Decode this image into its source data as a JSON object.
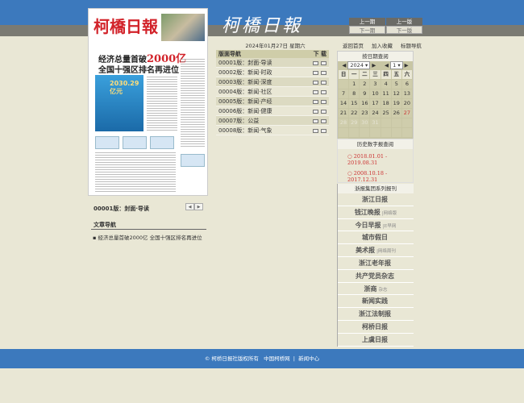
{
  "header": {
    "masthead": "柯橋日報",
    "prev_issue": "上一期",
    "next_issue": "下一期",
    "prev_page": "上一版",
    "next_page": "下一版"
  },
  "paper": {
    "logo": "柯橋日報",
    "headline1": "经济总量首破",
    "headline_num": "2000亿",
    "headline2": "全国十强区排名再进位",
    "figure": "2030.29亿元"
  },
  "date": "2024年01月27日 星期六",
  "pages": {
    "header": "版面导航",
    "download": "下 载",
    "items": [
      "00001版：封面·导读",
      "00002版：新闻·时政",
      "00003版：新闻·深度",
      "00004版：新闻·社区",
      "00005版：新闻·产经",
      "00006版：新闻·健康",
      "00007版：公益",
      "00008版：新闻·气象"
    ]
  },
  "current_page": "00001版：封面·导读",
  "article_nav": {
    "title": "文章导航",
    "items": [
      "经济总量首破2000亿 全国十强区排名再进位"
    ]
  },
  "links": [
    "返回首页",
    "加入收藏",
    "标题导航"
  ],
  "calendar": {
    "title": "按日期查阅",
    "year": "2024",
    "month": "1",
    "weekdays": [
      "日",
      "一",
      "二",
      "三",
      "四",
      "五",
      "六"
    ],
    "days": [
      "",
      "1",
      "2",
      "3",
      "4",
      "5",
      "6",
      "7",
      "8",
      "9",
      "10",
      "11",
      "12",
      "13",
      "14",
      "15",
      "16",
      "17",
      "18",
      "19",
      "20",
      "21",
      "22",
      "23",
      "24",
      "25",
      "26",
      "27",
      "28",
      "29",
      "30",
      "31",
      "",
      "",
      "",
      "",
      "",
      "",
      "",
      "",
      "",
      "",
      ""
    ],
    "today": "27"
  },
  "history": {
    "title": "历史数字报查阅",
    "ranges": [
      "2018.01.01 - 2019.08.31",
      "2008.10.18 - 2017.12.31"
    ]
  },
  "series": {
    "title": "浙报集团系列报刊",
    "items": [
      {
        "name": "浙江日报",
        "tag": ""
      },
      {
        "name": "钱江晚报",
        "tag": "|网络版"
      },
      {
        "name": "今日早报",
        "tag": "|E早网"
      },
      {
        "name": "城市假日",
        "tag": ""
      },
      {
        "name": "美术报",
        "tag": "|网络周刊"
      },
      {
        "name": "浙江老年报",
        "tag": ""
      },
      {
        "name": "共产党员杂志",
        "tag": ""
      },
      {
        "name": "浙商",
        "tag": "杂志"
      },
      {
        "name": "新闻实践",
        "tag": ""
      },
      {
        "name": "浙江法制报",
        "tag": ""
      },
      {
        "name": "柯桥日报",
        "tag": ""
      },
      {
        "name": "上虞日报",
        "tag": ""
      }
    ]
  },
  "footer": {
    "copyright": "© 柯桥日报社版权所有",
    "link1": "中国柯桥网",
    "sep": "|",
    "link2": "新闻中心"
  },
  "colors": {
    "blue": "#3c79bd",
    "beige": "#e9e7d5",
    "red": "#d2232a"
  }
}
